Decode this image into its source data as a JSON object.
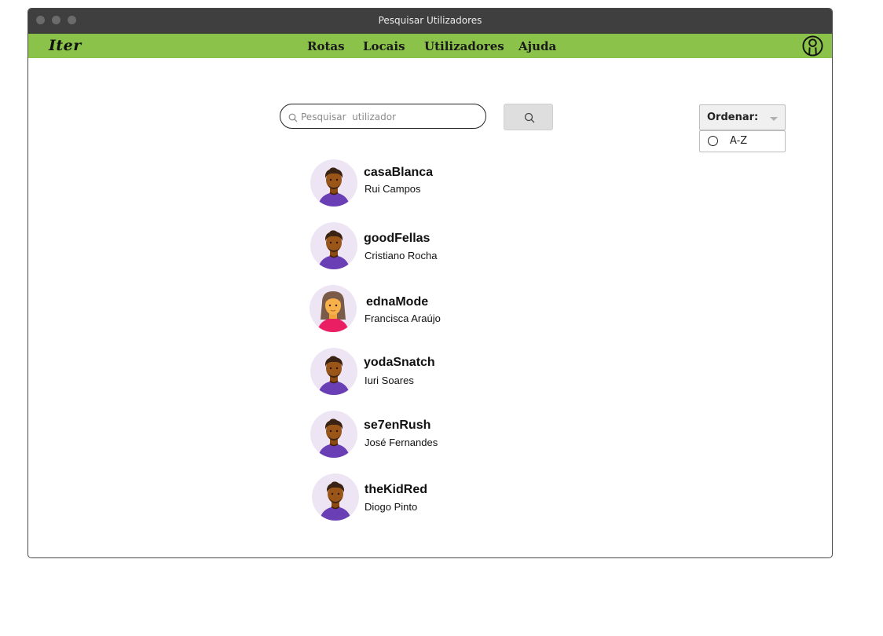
{
  "window": {
    "title": "Pesquisar Utilizadores"
  },
  "navbar": {
    "logo": "Iter",
    "links": [
      "Rotas",
      "Locais",
      "Utilizadores",
      "Ajuda"
    ]
  },
  "search": {
    "placeholder": "Pesquisar  utilizador",
    "value": ""
  },
  "sort": {
    "label": "Ordenar:",
    "option": "A-Z"
  },
  "users": [
    {
      "username": "casaBlanca",
      "name": "Rui Campos",
      "avatar": "male-avatar"
    },
    {
      "username": "goodFellas",
      "name": "Cristiano Rocha",
      "avatar": "male-avatar"
    },
    {
      "username": "ednaMode",
      "name": "Francisca Araújo",
      "avatar": "female-avatar"
    },
    {
      "username": "yodaSnatch",
      "name": "Iuri Soares",
      "avatar": "male-avatar"
    },
    {
      "username": "se7enRush",
      "name": "José Fernandes",
      "avatar": "male-avatar"
    },
    {
      "username": "theKidRed",
      "name": "Diogo Pinto",
      "avatar": "male-avatar"
    }
  ],
  "colors": {
    "navbar": "#8bc34a",
    "titlebar": "#3f3f3f",
    "avatar_bg": "#ede5f3",
    "male_shirt": "#6a3fb5",
    "female_shirt": "#e91e63"
  }
}
